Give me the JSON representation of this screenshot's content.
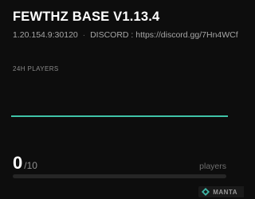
{
  "server": {
    "name": "FEWTHZ BASE V1.13.4",
    "address": "1.20.154.9:30120",
    "discord": "DISCORD : https://discord.gg/7Hn4WCf"
  },
  "chart_section": {
    "label": "24H PLAYERS"
  },
  "chart_data": {
    "type": "line",
    "title": "24H PLAYERS",
    "xlabel": "",
    "ylabel": "",
    "ylim": [
      0,
      10
    ],
    "series": [
      {
        "values": [
          0,
          0,
          0,
          0,
          0,
          0,
          0,
          0,
          0,
          0,
          0,
          0,
          0,
          0,
          0,
          0,
          0,
          0,
          0,
          0,
          0,
          0,
          0,
          0
        ]
      }
    ],
    "color": "#40c4a8",
    "grid": false
  },
  "players": {
    "current": "0",
    "max": "/10",
    "unit": "players",
    "fill_fraction": 0
  },
  "brand": {
    "name": "MANTA",
    "icon": "diamond-logo-icon",
    "color": "#3fb8a8"
  },
  "colors": {
    "accent": "#40c4a8",
    "background": "#0d0d0d"
  }
}
